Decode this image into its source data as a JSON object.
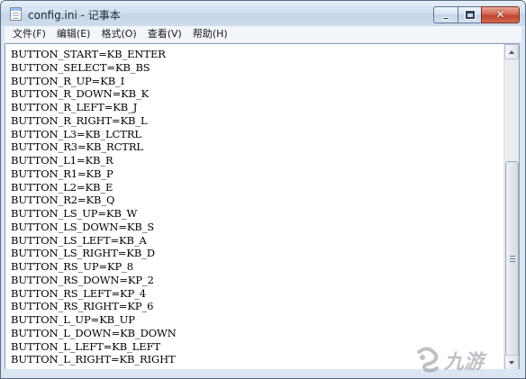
{
  "window": {
    "title": "config.ini - 记事本"
  },
  "menu": [
    {
      "label": "文件(F)"
    },
    {
      "label": "编辑(E)"
    },
    {
      "label": "格式(O)"
    },
    {
      "label": "查看(V)"
    },
    {
      "label": "帮助(H)"
    }
  ],
  "editor": {
    "lines": [
      "BUTTON_START=KB_ENTER",
      "BUTTON_SELECT=KB_BS",
      "BUTTON_R_UP=KB_I",
      "BUTTON_R_DOWN=KB_K",
      "BUTTON_R_LEFT=KB_J",
      "BUTTON_R_RIGHT=KB_L",
      "BUTTON_L3=KB_LCTRL",
      "BUTTON_R3=KB_RCTRL",
      "BUTTON_L1=KB_R",
      "BUTTON_R1=KB_P",
      "BUTTON_L2=KB_E",
      "BUTTON_R2=KB_Q",
      "BUTTON_LS_UP=KB_W",
      "BUTTON_LS_DOWN=KB_S",
      "BUTTON_LS_LEFT=KB_A",
      "BUTTON_LS_RIGHT=KB_D",
      "BUTTON_RS_UP=KP_8",
      "BUTTON_RS_DOWN=KP_2",
      "BUTTON_RS_LEFT=KP_4",
      "BUTTON_RS_RIGHT=KP_6",
      "BUTTON_L_UP=KB_UP",
      "BUTTON_L_DOWN=KB_DOWN",
      "BUTTON_L_LEFT=KB_LEFT",
      "BUTTON_L_RIGHT=KB_RIGHT"
    ]
  },
  "watermark": {
    "text": "九游",
    "logo_icon": "jiuyou-logo-icon"
  },
  "colors": {
    "frame": "#dbe6f3",
    "close_button": "#c0432c",
    "text": "#000000"
  }
}
